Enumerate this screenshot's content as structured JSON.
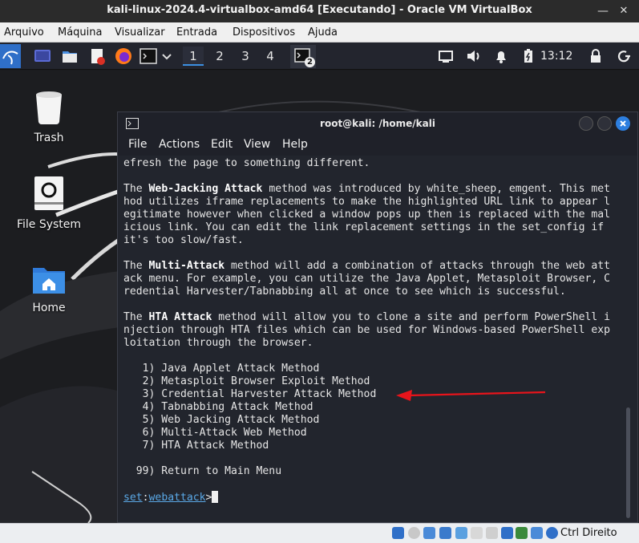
{
  "host_window": {
    "title": "kali-linux-2024.4-virtualbox-amd64 [Executando] - Oracle VM VirtualBox",
    "menu": [
      "Arquivo",
      "Máquina",
      "Visualizar",
      "Entrada",
      "Dispositivos",
      "Ajuda"
    ],
    "host_key": "Ctrl Direito"
  },
  "panel": {
    "workspaces": [
      "1",
      "2",
      "3",
      "4"
    ],
    "active_workspace": "1",
    "terminal_badge": "2",
    "clock": "13:12"
  },
  "desktop": {
    "icons": [
      {
        "label": "Trash",
        "icon": "trash-icon"
      },
      {
        "label": "File System",
        "icon": "drive-icon"
      },
      {
        "label": "Home",
        "icon": "home-folder-icon"
      }
    ]
  },
  "terminal": {
    "title": "root@kali: /home/kali",
    "menu": [
      "File",
      "Actions",
      "Edit",
      "View",
      "Help"
    ],
    "lines": [
      "efresh the page to something different.",
      "",
      "The |Web-Jacking Attack| method was introduced by white_sheep, emgent. This met",
      "hod utilizes iframe replacements to make the highlighted URL link to appear l",
      "egitimate however when clicked a window pops up then is replaced with the mal",
      "icious link. You can edit the link replacement settings in the set_config if",
      "it's too slow/fast.",
      "",
      "The |Multi-Attack| method will add a combination of attacks through the web att",
      "ack menu. For example, you can utilize the Java Applet, Metasploit Browser, C",
      "redential Harvester/Tabnabbing all at once to see which is successful.",
      "",
      "The |HTA Attack| method will allow you to clone a site and perform PowerShell i",
      "njection through HTA files which can be used for Windows-based PowerShell exp",
      "loitation through the browser.",
      "",
      "   1) Java Applet Attack Method",
      "   2) Metasploit Browser Exploit Method",
      "   3) Credential Harvester Attack Method",
      "   4) Tabnabbing Attack Method",
      "   5) Web Jacking Attack Method",
      "   6) Multi-Attack Web Method",
      "   7) HTA Attack Method",
      "",
      "  99) Return to Main Menu",
      ""
    ],
    "prompt": {
      "set": "set",
      "sep": ":",
      "module": "webattack",
      "suffix": ">"
    }
  },
  "colors": {
    "accent": "#3c8fe0",
    "annotation_arrow": "#e8141b",
    "terminal_bg": "#22252d"
  }
}
